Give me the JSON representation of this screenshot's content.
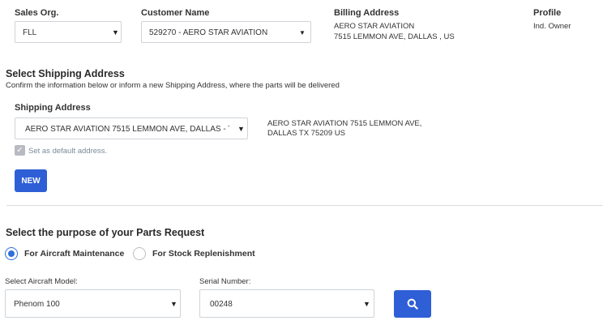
{
  "header": {
    "sales_org": {
      "label": "Sales Org.",
      "value": "FLL"
    },
    "customer": {
      "label": "Customer Name",
      "value": "529270 - AERO STAR AVIATION"
    },
    "billing": {
      "label": "Billing Address",
      "line1": "AERO STAR AVIATION",
      "line2": "7515 LEMMON AVE, DALLAS , US"
    },
    "profile": {
      "label": "Profile",
      "value": "Ind. Owner"
    }
  },
  "shipping": {
    "title": "Select Shipping Address",
    "description": "Confirm the information below or inform a new Shipping Address, where the parts will be delivered",
    "field_label": "Shipping Address",
    "selected": "AERO STAR AVIATION 7515 LEMMON AVE, DALLAS - T",
    "address_line1": "AERO STAR AVIATION 7515 LEMMON AVE,",
    "address_line2": "DALLAS TX 75209 US",
    "default_checkbox": {
      "label": "Set as default address.",
      "checked": true
    },
    "new_button": "NEW"
  },
  "purpose": {
    "title": "Select the purpose of your Parts Request",
    "options": [
      {
        "label": "For Aircraft Maintenance",
        "selected": true
      },
      {
        "label": "For Stock Replenishment",
        "selected": false
      }
    ],
    "aircraft_model": {
      "label": "Select Aircraft Model:",
      "value": "Phenom 100"
    },
    "serial_number": {
      "label": "Serial Number:",
      "value": "00248"
    },
    "search_icon": "search-icon"
  },
  "colors": {
    "accent": "#2f5fd6",
    "radio": "#2f6fdc",
    "border": "#cfd3d8"
  }
}
